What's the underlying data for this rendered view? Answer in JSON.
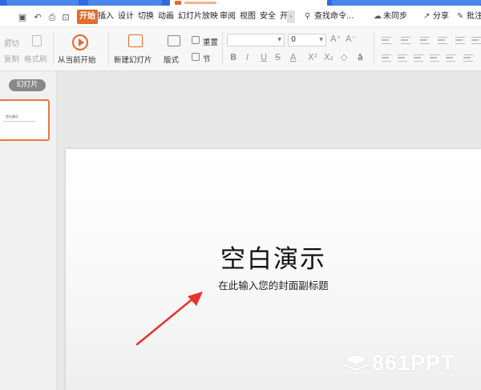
{
  "menu": {
    "items": [
      "开始",
      "插入",
      "设计",
      "切换",
      "动画",
      "幻灯片放映",
      "审阅",
      "视图",
      "安全",
      "开"
    ],
    "active": "开始",
    "search": "查找命令...",
    "sync": "未同步",
    "share": "分享",
    "review": "批注"
  },
  "ribbon": {
    "cut": "剪切",
    "copy": "复制",
    "format_painter": "格式刷",
    "play_from_current": "从当前开始",
    "new_slide": "新建幻灯片",
    "layout": "版式",
    "reset": "重置",
    "section": "节",
    "font_size": "0",
    "font_grow": "A⁺",
    "font_shrink": "A⁻",
    "bold": "B",
    "italic": "I",
    "underline": "U",
    "strike": "S",
    "font_color": "A",
    "superscript": "X²",
    "subscript": "X₂",
    "clear": "◇",
    "char_spacing": "ā"
  },
  "left_panel": {
    "tab": "幻灯片",
    "thumb_title": "空白演示"
  },
  "slide": {
    "title": "空白演示",
    "subtitle": "在此输入您的封面副标题"
  },
  "watermark": "861PPT",
  "colors": {
    "accent": "#e36b2c",
    "tabstrip": "#2e6be0",
    "arrow": "#e8332b"
  }
}
